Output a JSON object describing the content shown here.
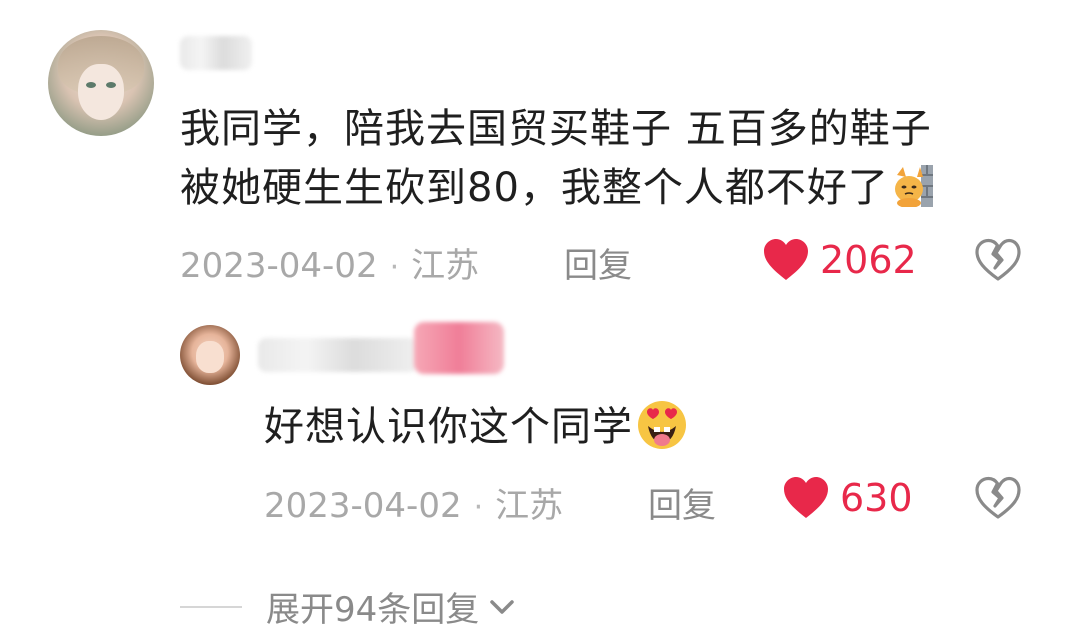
{
  "comment": {
    "text_line1": "我同学，陪我去国贸买鞋子 五百多的鞋子",
    "text_line2": "被她硬生生砍到80，我整个人都不好了",
    "date": "2023-04-02",
    "location": "江苏",
    "reply_label": "回复",
    "likes": "2062"
  },
  "reply": {
    "text": "好想认识你这个同学",
    "date": "2023-04-02",
    "location": "江苏",
    "reply_label": "回复",
    "likes": "630"
  },
  "expand": {
    "label": "展开94条回复"
  },
  "icons": {
    "cat_emoji": "cat-face-with-wall-icon",
    "face_emoji": "heart-eyes-tongue-face-icon",
    "like": "heart-icon",
    "dislike": "broken-heart-icon",
    "chevron": "chevron-down-icon"
  },
  "colors": {
    "like_heart": "#e8284a",
    "meta_text": "#a8a8a8",
    "body_text": "#1f1f1f"
  }
}
